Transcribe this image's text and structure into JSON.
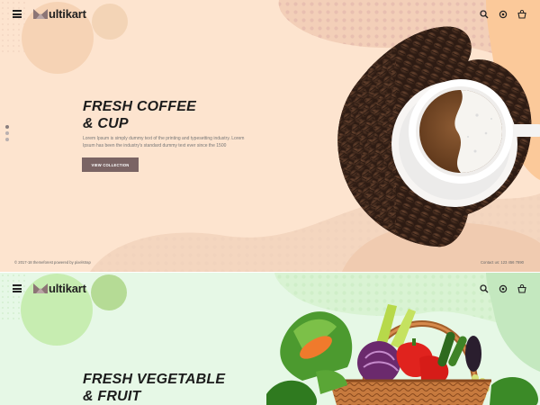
{
  "coffee_slide": {
    "brand": "ultikart",
    "title_line1": "FRESH COFFEE",
    "title_line2": "& CUP",
    "description": "Lorem Ipsum is simply dummy text of the printing and typesetting industry. Lorem Ipsum has been the industry's standard dummy text ever since the 1500",
    "button_label": "VIEW COLLECTION",
    "footer_left": "© 2017-18 themeforest powered by pixelstrap",
    "footer_right": "Contact us: 123 456 7890",
    "colors": {
      "background": "#fde4cf",
      "button": "#7a6464"
    }
  },
  "vegetable_slide": {
    "brand": "ultikart",
    "title_line1": "FRESH VEGETABLE",
    "title_line2": "& FRUIT",
    "colors": {
      "background": "#e6f8e6"
    }
  },
  "icons": [
    "menu-icon",
    "search-icon",
    "settings-icon",
    "cart-icon"
  ]
}
